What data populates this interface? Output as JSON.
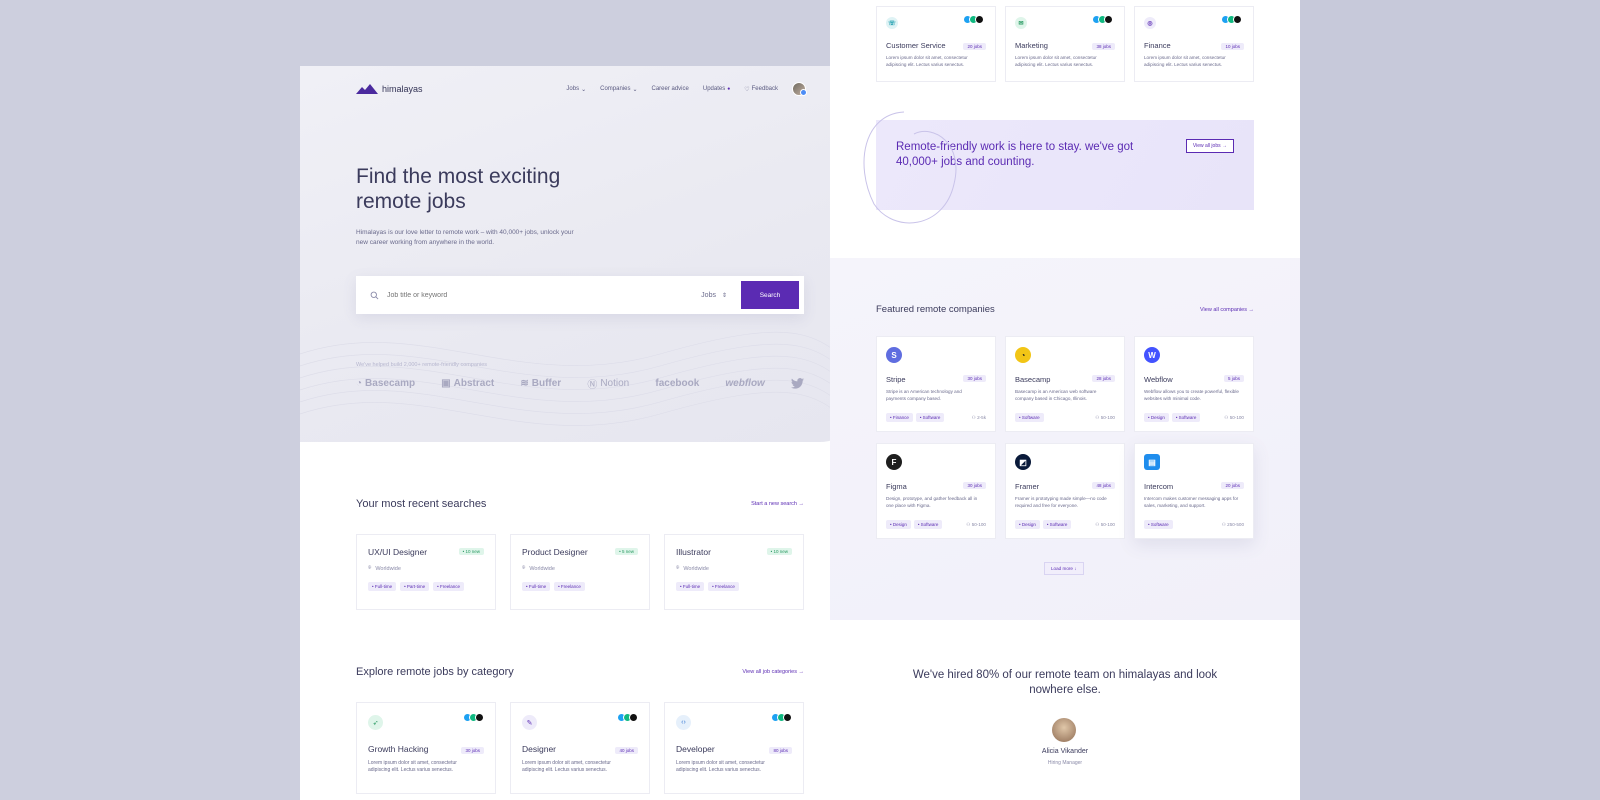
{
  "nav": {
    "brand": "himalayas",
    "items": [
      "Jobs",
      "Companies",
      "Career advice",
      "Updates",
      "Feedback"
    ]
  },
  "hero": {
    "title": "Find the most exciting remote jobs",
    "subtitle": "Himalayas is our love letter to remote work – with 40,000+ jobs, unlock your new career working from anywhere in the world.",
    "search_placeholder": "Job title or keyword",
    "search_type": "Jobs",
    "search_button": "Search",
    "helped_text": "We've helped build 2,000+ remote-friendly companies",
    "logos": [
      "Basecamp",
      "Abstract",
      "Buffer",
      "Notion",
      "facebook",
      "webflow"
    ]
  },
  "recent": {
    "title": "Your most recent searches",
    "link": "Start a new search",
    "cards": [
      {
        "title": "UX/UI Designer",
        "badge": "• 10 new",
        "location": "Worldwide",
        "tags": [
          "• Full-time",
          "• Part-time",
          "• Freelance"
        ]
      },
      {
        "title": "Product Designer",
        "badge": "• 5 new",
        "location": "Worldwide",
        "tags": [
          "• Full-time",
          "• Freelance"
        ]
      },
      {
        "title": "Illustrator",
        "badge": "• 10 new",
        "location": "Worldwide",
        "tags": [
          "• Full-time",
          "• Freelance"
        ]
      }
    ]
  },
  "category": {
    "title": "Explore remote jobs by category",
    "link": "View all job categories",
    "cards": [
      {
        "title": "Growth Hacking",
        "jobs": "30 jobs",
        "desc": "Lorem ipsum dolor sit amet, consectetur adipiscing elit. Lectus varius senectus.",
        "icon_color": "#dff5ea"
      },
      {
        "title": "Designer",
        "jobs": "40 jobs",
        "desc": "Lorem ipsum dolor sit amet, consectetur adipiscing elit. Lectus varius senectus.",
        "icon_color": "#eeebfa"
      },
      {
        "title": "Developer",
        "jobs": "80 jobs",
        "desc": "Lorem ipsum dolor sit amet, consectetur adipiscing elit. Lectus varius senectus.",
        "icon_color": "#e6f0fb"
      }
    ]
  },
  "top_categories": [
    {
      "title": "Customer Service",
      "jobs": "20 jobs",
      "desc": "Lorem ipsum dolor sit amet, consectetur adipiscing elit. Lectus varius senectus.",
      "icon_color": "#dff3f5"
    },
    {
      "title": "Marketing",
      "jobs": "38 jobs",
      "desc": "Lorem ipsum dolor sit amet, consectetur adipiscing elit. Lectus varius senectus.",
      "icon_color": "#dff5ea"
    },
    {
      "title": "Finance",
      "jobs": "10 jobs",
      "desc": "Lorem ipsum dolor sit amet, consectetur adipiscing elit. Lectus varius senectus.",
      "icon_color": "#eeebfa"
    }
  ],
  "promo": {
    "text": "Remote-friendly work is here to stay. we've got 40,000+ jobs and counting.",
    "link": "View all jobs"
  },
  "featured": {
    "title": "Featured remote companies",
    "link": "View all companies",
    "companies": [
      {
        "name": "Stripe",
        "jobs": "30 jobs",
        "desc": "Stripe is an American technology and payments company based.",
        "tags": [
          "• Finance",
          "• Software"
        ],
        "size": "2-5k",
        "color": "#5f6de0",
        "letter": "S"
      },
      {
        "name": "Basecamp",
        "jobs": "28 jobs",
        "desc": "Basecamp is an American web software company based in Chicago, Illinois.",
        "tags": [
          "• Software"
        ],
        "size": "50-100",
        "color": "#f2c516",
        "letter": "B"
      },
      {
        "name": "Webflow",
        "jobs": "5 jobs",
        "desc": "Webflow allows you to create powerful, flexible websites with minimal code.",
        "tags": [
          "• Design",
          "• Software"
        ],
        "size": "50-100",
        "color": "#4353ff",
        "letter": "W"
      },
      {
        "name": "Figma",
        "jobs": "30 jobs",
        "desc": "Design, prototype, and gather feedback all in one place with Figma.",
        "tags": [
          "• Design",
          "• Software"
        ],
        "size": "50-100",
        "color": "#1e1e1e",
        "letter": "F"
      },
      {
        "name": "Framer",
        "jobs": "48 jobs",
        "desc": "Framer is prototyping made simple—no code required and free for everyone.",
        "tags": [
          "• Design",
          "• Software"
        ],
        "size": "50-100",
        "color": "#0a1a3a",
        "letter": "F"
      },
      {
        "name": "Intercom",
        "jobs": "20 jobs",
        "desc": "Intercom makes customer messaging apps for sales, marketing, and support.",
        "tags": [
          "• Software"
        ],
        "size": "250-500",
        "color": "#1f8ded",
        "letter": "I"
      }
    ],
    "load_more": "Load more"
  },
  "testimonial": {
    "quote": "We've hired 80% of our remote team on himalayas and look nowhere else.",
    "name": "Alicia Vikander",
    "role": "Hiring Manager"
  }
}
